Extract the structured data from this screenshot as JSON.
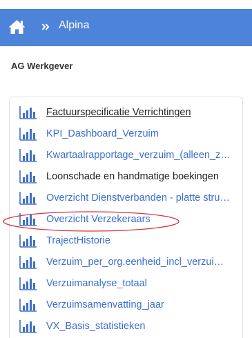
{
  "header": {
    "breadcrumb": "Alpina"
  },
  "section": {
    "title": "AG Werkgever"
  },
  "reports": [
    {
      "label": "Factuurspecificatie Verrichtingen",
      "style": "underlined"
    },
    {
      "label": "KPI_Dashboard_Verzuim",
      "style": "link"
    },
    {
      "label": "Kwartaalrapportage_verzuim_(alleen_zi…",
      "style": "link"
    },
    {
      "label": "Loonschade en handmatige boekingen",
      "style": "dark"
    },
    {
      "label": "Overzicht Dienstverbanden - platte stru…",
      "style": "link"
    },
    {
      "label": "Overzicht Verzekeraars",
      "style": "link",
      "highlighted": true
    },
    {
      "label": "TrajectHistorie",
      "style": "link"
    },
    {
      "label": "Verzuim_per_org.eenheid_incl_verzuim…",
      "style": "link"
    },
    {
      "label": "Verzuimanalyse_totaal",
      "style": "link"
    },
    {
      "label": "Verzuimsamenvatting_jaar",
      "style": "link"
    },
    {
      "label": "VX_Basis_statistieken",
      "style": "link"
    }
  ],
  "colors": {
    "header_bg": "#4d83d8",
    "link": "#3a6ed3",
    "icon": "#3f6fc9",
    "highlight": "#d9333a"
  },
  "icons": {
    "home": "home-icon",
    "separator": "chevron-double-right-icon",
    "report": "bar-chart-icon"
  }
}
